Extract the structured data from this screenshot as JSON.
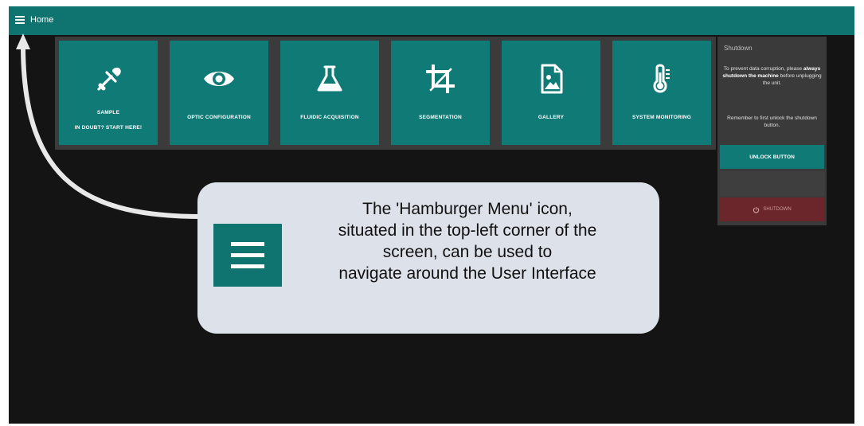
{
  "topbar": {
    "menu_icon": "hamburger-menu-icon",
    "title": "Home",
    "color": "#0f7370"
  },
  "tiles": [
    {
      "icon": "pipette-icon",
      "label": "SAMPLE",
      "sublabel": "IN DOUBT? START HERE!"
    },
    {
      "icon": "eye-icon",
      "label": "OPTIC CONFIGURATION"
    },
    {
      "icon": "flask-icon",
      "label": "FLUIDIC ACQUISITION"
    },
    {
      "icon": "crop-icon",
      "label": "SEGMENTATION"
    },
    {
      "icon": "image-icon",
      "label": "GALLERY"
    },
    {
      "icon": "thermometer-icon",
      "label": "SYSTEM MONITORING"
    }
  ],
  "shutdown": {
    "title": "Shutdown",
    "text_before": "To prevent data corruption, please ",
    "text_bold": "always shutdown the machine",
    "text_after": " before unplugging the unit.",
    "reminder": "Remember to first unlock the shutdown button.",
    "unlock_label": "UNLOCK BUTTON",
    "shutdown_label": "SHUTDOWN",
    "shutdown_icon": "power-icon"
  },
  "callout": {
    "icon": "hamburger-menu-icon",
    "lines": [
      "The 'Hamburger Menu' icon,",
      "situated in the top-left corner of the",
      "screen, can be used to",
      "navigate around the User Interface"
    ],
    "arrow_color": "#e8e8e8"
  },
  "colors": {
    "tile": "#107a76",
    "background": "#141414",
    "shutdown_button": "#6b262c",
    "callout_bg": "#dde1ea"
  }
}
